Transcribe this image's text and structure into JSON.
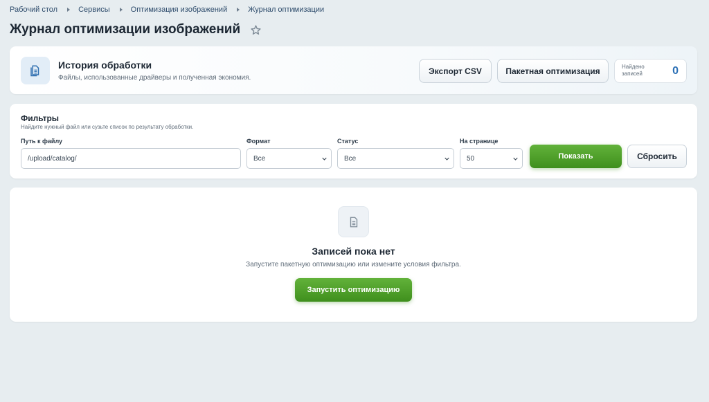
{
  "breadcrumb": [
    "Рабочий стол",
    "Сервисы",
    "Оптимизация изображений",
    "Журнал оптимизации"
  ],
  "page": {
    "title": "Журнал оптимизации изображений"
  },
  "header": {
    "title": "История обработки",
    "subtitle": "Файлы, использованные драйверы и полученная экономия.",
    "export_label": "Экспорт CSV",
    "batch_label": "Пакетная оптимизация",
    "found_label": "Найдено записей",
    "found_count": "0"
  },
  "filters": {
    "title": "Фильтры",
    "subtitle": "Найдите нужный файл или сузьте список по результату обработки.",
    "path_label": "Путь к файлу",
    "path_value": "/upload/catalog/",
    "format_label": "Формат",
    "format_value": "Все",
    "status_label": "Статус",
    "status_value": "Все",
    "per_page_label": "На странице",
    "per_page_value": "50",
    "show_label": "Показать",
    "reset_label": "Сбросить"
  },
  "empty": {
    "title": "Записей пока нет",
    "subtitle": "Запустите пакетную оптимизацию или измените условия фильтра.",
    "run_label": "Запустить оптимизацию"
  },
  "colors": {
    "accent_green": "#4f9f2a",
    "count_blue": "#2a6fb5",
    "background": "#e7edf0"
  },
  "icons": [
    "star-icon",
    "document-icon",
    "chevron-down-icon"
  ]
}
